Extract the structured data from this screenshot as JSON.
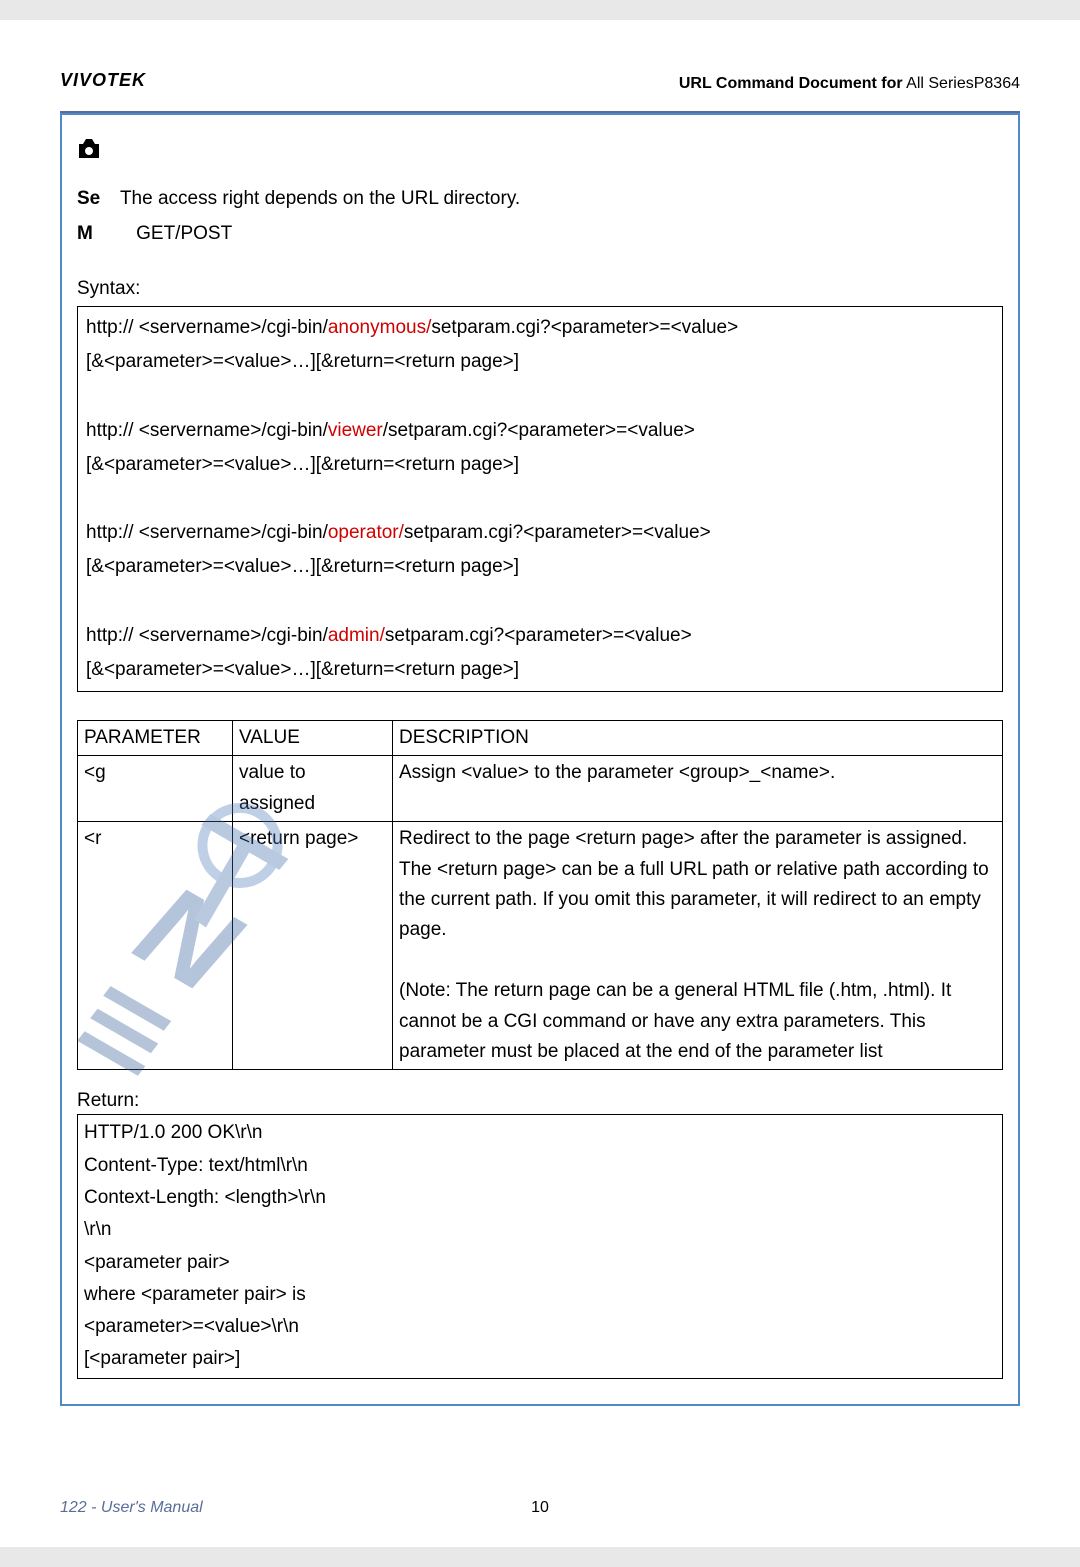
{
  "brand": "VIVOTEK",
  "header": {
    "prefix": "URL Command Document for",
    "series": "  All SeriesP8364"
  },
  "security": {
    "line1": "The access right depends on the URL directory.",
    "method": "GET/POST"
  },
  "syntax_label": "Syntax:",
  "syntax": {
    "http": "http://   <servername>/cgi-bin/",
    "anon": "anonymous/",
    "viewer": "viewer",
    "operator": "operator/",
    "admin": "admin/",
    "setparam_anon": "setparam.cgi?<parameter>=<value>",
    "setparam_rest": "/setparam.cgi?<parameter>=<value>",
    "tail": "[&<parameter>=<value>…][&return=<return page>]"
  },
  "table": {
    "h1": "PARAMETER",
    "h2": "VALUE",
    "h3": "DESCRIPTION",
    "r1c1": "<g",
    "r1c2": "value to assigned",
    "r1c3": "  Assign <value> to the parameter <group>_<name>.",
    "r2c1": "<r",
    "r2c2": "<return page>",
    "r2c3": "Redirect to the page <return page> after the parameter is assigned. The <return page> can be a full URL path or relative path according to the current path. If you omit this parameter, it will redirect to an empty page.\n\n(Note: The return page can be a general HTML file (.htm, .html). It cannot be a CGI command or have any extra parameters. This parameter must be placed at the end of the parameter list"
  },
  "return_label": "Return:",
  "return_box": {
    "l1": "HTTP/1.0 200 OK\\r\\n",
    "l2": "Content-Type: text/html\\r\\n",
    "l3": "Context-Length: <length>\\r\\n",
    "l4": "\\r\\n",
    "l5": "<parameter pair>",
    "l6": "where <parameter pair> is",
    "l7": "<parameter>=<value>\\r\\n",
    "l8": "[<parameter pair>]"
  },
  "footer": {
    "left": "122 - User's Manual",
    "center": "10"
  }
}
